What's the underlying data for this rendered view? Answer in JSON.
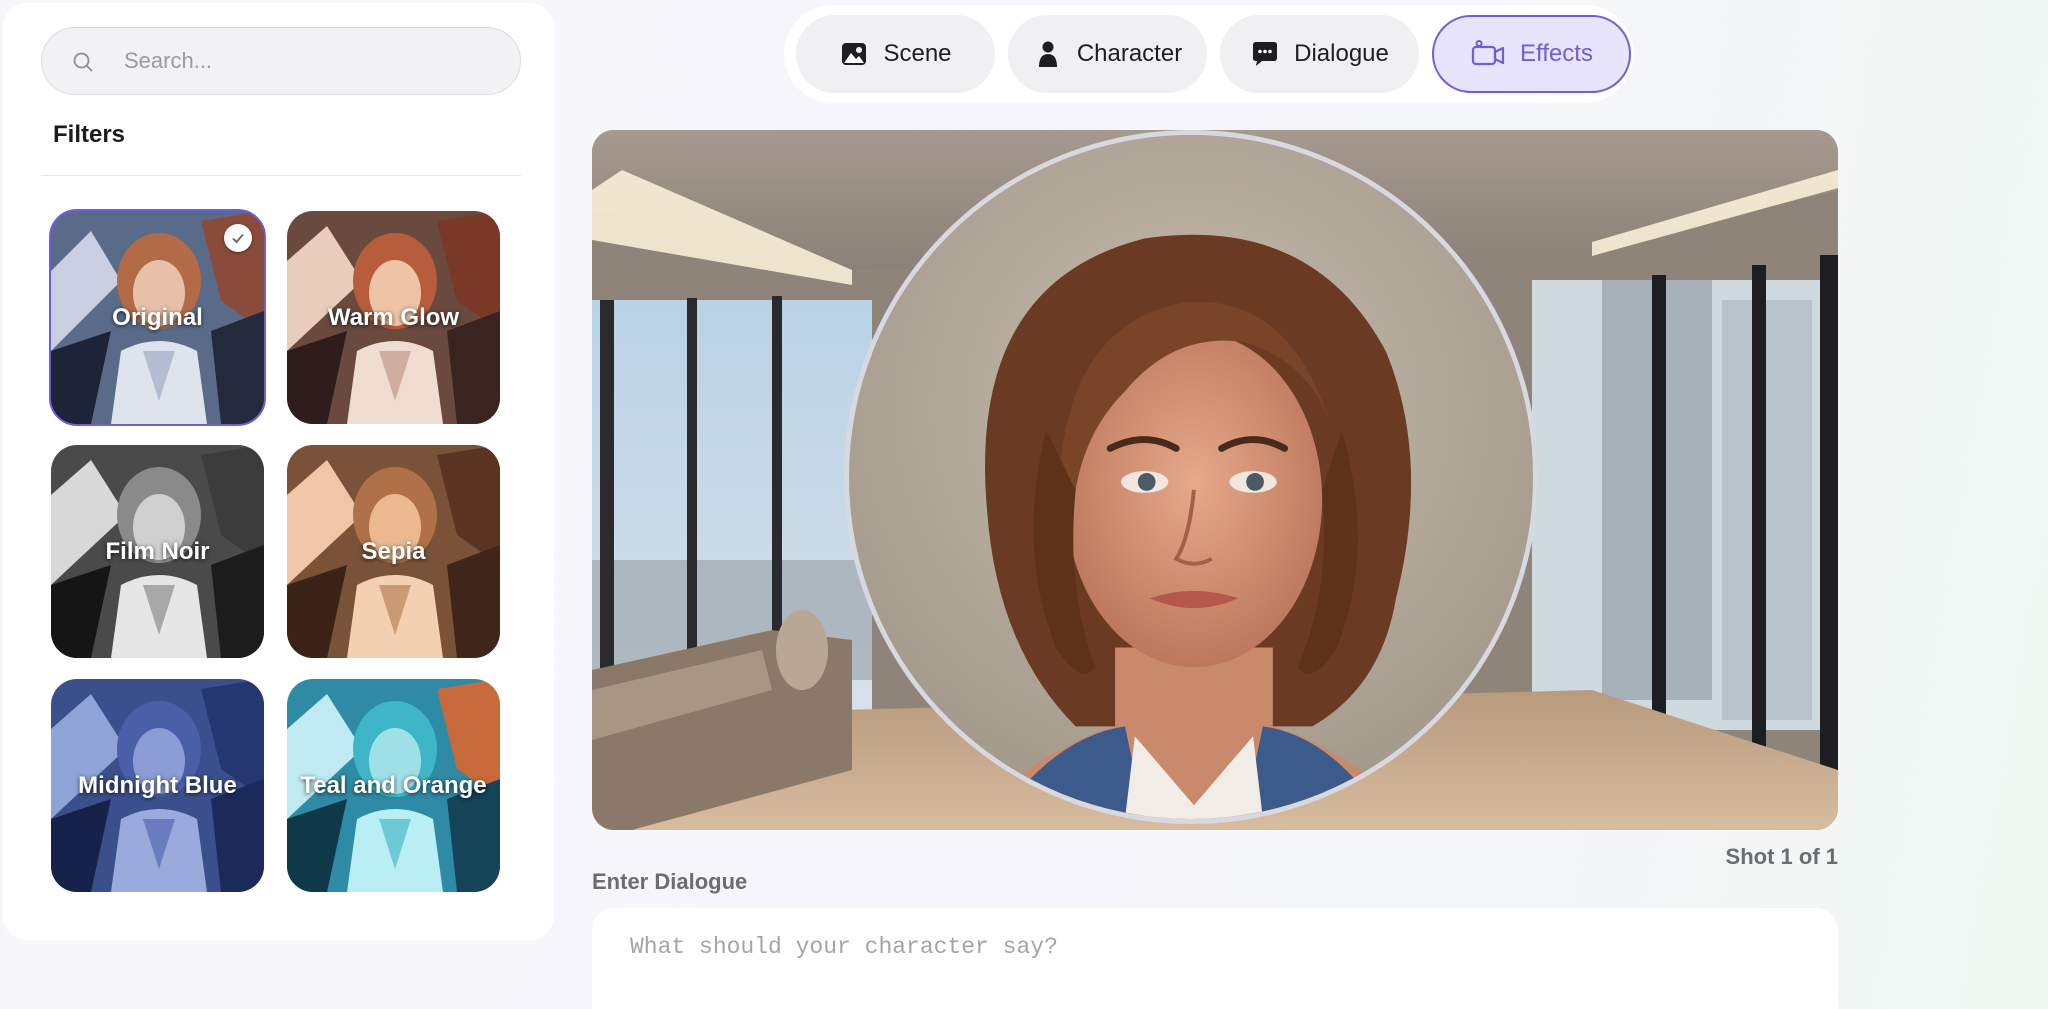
{
  "search": {
    "placeholder": "Search..."
  },
  "filters": {
    "title": "Filters",
    "selected": "Original",
    "items": [
      {
        "label": "Original"
      },
      {
        "label": "Warm Glow"
      },
      {
        "label": "Film Noir"
      },
      {
        "label": "Sepia"
      },
      {
        "label": "Midnight Blue"
      },
      {
        "label": "Teal and Orange"
      }
    ]
  },
  "tabs": [
    {
      "label": "Scene",
      "icon": "image-icon"
    },
    {
      "label": "Character",
      "icon": "person-icon"
    },
    {
      "label": "Dialogue",
      "icon": "chat-bubble-icon"
    },
    {
      "label": "Effects",
      "icon": "video-camera-icon",
      "active": true
    }
  ],
  "preview": {
    "shot_counter": "Shot 1 of 1"
  },
  "dialogue": {
    "label": "Enter Dialogue",
    "placeholder": "What should your character say?"
  },
  "colors": {
    "accent": "#6d5fd6",
    "accent_bg": "#e8e4fb"
  }
}
